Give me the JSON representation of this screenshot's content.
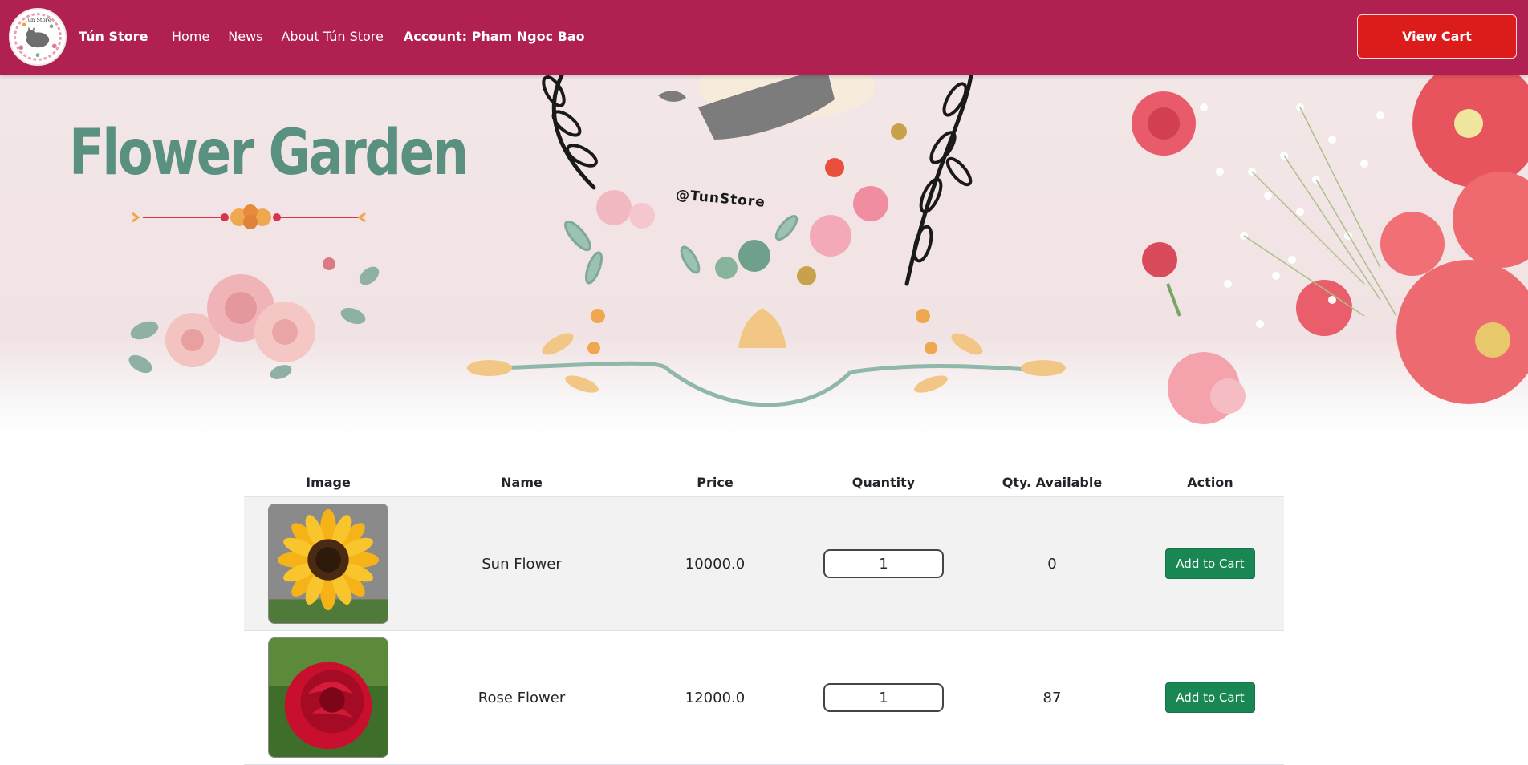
{
  "navbar": {
    "logo_text": "Tún Store",
    "brand": "Tún Store",
    "links": [
      "Home",
      "News",
      "About Tún Store"
    ],
    "account": "Account: Pham Ngoc Bao",
    "view_cart": "View Cart",
    "background": "#b02050"
  },
  "banner": {
    "title": "Flower Garden",
    "tag": "@TunStore"
  },
  "table": {
    "headers": [
      "Image",
      "Name",
      "Price",
      "Quantity",
      "Qty. Available",
      "Action"
    ],
    "rows": [
      {
        "image_icon": "sunflower-image",
        "name": "Sun Flower",
        "price": "10000.0",
        "quantity": "1",
        "available": "0",
        "action": "Add to Cart"
      },
      {
        "image_icon": "rose-image",
        "name": "Rose Flower",
        "price": "12000.0",
        "quantity": "1",
        "available": "87",
        "action": "Add to Cart"
      }
    ]
  },
  "colors": {
    "accent": "#b02050",
    "cart_button": "#dc1b1b",
    "add_button": "#198754",
    "title": "#5a9080"
  }
}
